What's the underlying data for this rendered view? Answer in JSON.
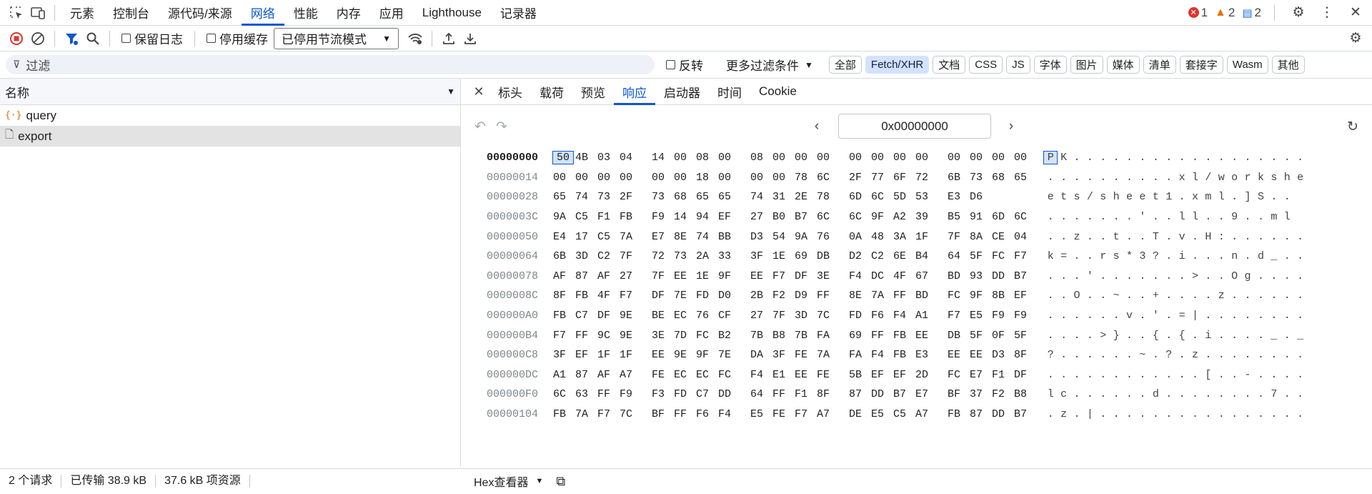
{
  "top_tabs": [
    "元素",
    "控制台",
    "源代码/来源",
    "网络",
    "性能",
    "内存",
    "应用",
    "Lighthouse",
    "记录器"
  ],
  "active_top_tab": "网络",
  "badges": {
    "errors": "1",
    "warnings": "2",
    "messages": "2"
  },
  "toolbar": {
    "preserve_log": "保留日志",
    "disable_cache": "停用缓存",
    "throttle": "已停用节流模式"
  },
  "filter": {
    "placeholder": "过滤",
    "invert": "反转",
    "more_filters": "更多过滤条件"
  },
  "type_filters": [
    "全部",
    "Fetch/XHR",
    "文档",
    "CSS",
    "JS",
    "字体",
    "图片",
    "媒体",
    "清单",
    "套接字",
    "Wasm",
    "其他"
  ],
  "active_type_filter": "Fetch/XHR",
  "requests_header": "名称",
  "requests": [
    {
      "name": "query",
      "type": "xhr"
    },
    {
      "name": "export",
      "type": "doc"
    }
  ],
  "detail_tabs": [
    "标头",
    "载荷",
    "预览",
    "响应",
    "启动器",
    "时间",
    "Cookie"
  ],
  "active_detail_tab": "响应",
  "hex_address": "0x00000000",
  "hex_rows": [
    {
      "offset": "00000000",
      "bytes": "50 4B 03 04 14 00 08 00 08 00 00 00 00 00 00 00 00 00 00 00",
      "ascii": "PK.................."
    },
    {
      "offset": "00000014",
      "bytes": "00 00 00 00 00 00 18 00 00 00 78 6C 2F 77 6F 72 6B 73 68 65",
      "ascii": "..........xl/workshe"
    },
    {
      "offset": "00000028",
      "bytes": "65 74 73 2F 73 68 65 65 74 31 2E 78 6D 6C 5D 53 E3 D6",
      "ascii": "ets/sheet1.xml.]S.."
    },
    {
      "offset": "0000003C",
      "bytes": "9A C5 F1 FB F9 14 94 EF 27 B0 B7 6C 6C 9F A2 39 B5 91 6D 6C",
      "ascii": ".......'..ll..9..ml"
    },
    {
      "offset": "00000050",
      "bytes": "E4 17 C5 7A E7 8E 74 BB D3 54 9A 76 0A 48 3A 1F 7F 8A CE 04",
      "ascii": "..z..t..T.v.H:......"
    },
    {
      "offset": "00000064",
      "bytes": "6B 3D C2 7F 72 73 2A 33 3F 1E 69 DB D2 C2 6E B4 64 5F FC F7",
      "ascii": "k=..rs*3?.i...n.d_.."
    },
    {
      "offset": "00000078",
      "bytes": "AF 87 AF 27 7F EE 1E 9F EE F7 DF 3E F4 DC 4F 67 BD 93 DD B7",
      "ascii": "...'.......>..Og...."
    },
    {
      "offset": "0000008C",
      "bytes": "8F FB 4F F7 DF 7E FD D0 2B F2 D9 FF 8E 7A FF BD FC 9F 8B EF",
      "ascii": "..O..~..+....z......"
    },
    {
      "offset": "000000A0",
      "bytes": "FB C7 DF 9E BE EC 76 CF 27 7F 3D 7C FD F6 F4 A1 F7 E5 F9 F9",
      "ascii": "......v.'.=|........"
    },
    {
      "offset": "000000B4",
      "bytes": "F7 FF 9C 9E 3E 7D FC B2 7B B8 7B FA 69 FF FB EE DB 5F 0F 5F",
      "ascii": "....>}..{.{.i...._._"
    },
    {
      "offset": "000000C8",
      "bytes": "3F EF 1F 1F EE 9E 9F 7E DA 3F FE 7A FA F4 FB E3 EE EE D3 8F",
      "ascii": "?......~.?.z........"
    },
    {
      "offset": "000000DC",
      "bytes": "A1 87 AF A7 FE EC EC FC F4 E1 EE FE 5B EF EF 2D FC E7 F1 DF",
      "ascii": "............[..-...."
    },
    {
      "offset": "000000F0",
      "bytes": "6C 63 FF F9 F3 FD C7 DD 64 FF F1 8F 87 DD B7 E7 BF 37 F2 B8",
      "ascii": "lc......d........7.."
    },
    {
      "offset": "00000104",
      "bytes": "FB 7A F7 7C BF FF F6 F4 E5 FE F7 A7 DE E5 C5 A7 FB 87 DD B7",
      "ascii": ".z.|................"
    }
  ],
  "status": {
    "requests": "2 个请求",
    "transferred": "已传输 38.9 kB",
    "resources": "37.6 kB 项资源"
  },
  "response_view": "Hex查看器",
  "colors": {
    "accent": "#0b57d0",
    "error": "#dc362e",
    "warning": "#e37400",
    "info": "#1a73e8"
  }
}
